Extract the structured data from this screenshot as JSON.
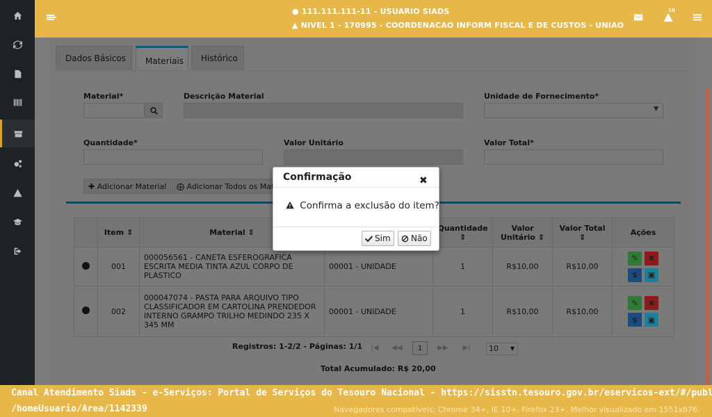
{
  "header": {
    "user": "111.111.111-11 - USUARIO SIADS",
    "unit": "NIVEL 1 - 170995 - COORDENACAO INFORM FISCAL E DE CUSTOS - UNIAO",
    "notification_count": "10"
  },
  "sidebar": {
    "items": [
      "home-icon",
      "refresh-icon",
      "document-icon",
      "barcode-icon",
      "inventory-icon",
      "gears-icon",
      "warning-icon",
      "graduation-cap-icon",
      "logout-icon"
    ]
  },
  "tabs": [
    {
      "label": "Dados Básicos"
    },
    {
      "label": "Materiais"
    },
    {
      "label": "Histórico"
    }
  ],
  "form": {
    "material_label": "Material*",
    "descricao_label": "Descrição Material",
    "unidade_label": "Unidade de Fornecimento*",
    "quantidade_label": "Quantidade*",
    "valor_unitario_label": "Valor Unitário",
    "valor_total_label": "Valor Total*",
    "add_material": "Adicionar Material",
    "add_all": "Adicionar Todos os Mat"
  },
  "table": {
    "headers": [
      "Item",
      "Material",
      "Quantidade",
      "Valor Unitário",
      "Valor Total",
      "Ações"
    ],
    "rows": [
      {
        "item": "001",
        "material": "000056561 - CANETA ESFEROGRAFICA ESCRITA MEDIA TINTA AZUL CORPO DE PLASTICO",
        "unidade": "00001 - UNIDADE",
        "quantidade": "1",
        "valor_unitario": "R$10,00",
        "valor_total": "R$10,00"
      },
      {
        "item": "002",
        "material": "000047074 - PASTA PARA ARQUIVO TIPO CLASSIFICADOR EM CARTOLINA PRENDEDOR INTERNO GRAMPO TRILHO MEDINDO 235 X 345 MM",
        "unidade": "00001 - UNIDADE",
        "quantidade": "1",
        "valor_unitario": "R$10,00",
        "valor_total": "R$10,00"
      }
    ]
  },
  "pager": {
    "summary": "Registros: 1-2/2 - Páginas: 1/1",
    "current_page": "1",
    "page_size": "10"
  },
  "total": "Total Acumulado: R$ 20,00",
  "footer": {
    "line1": "Canal Atendimento Siads - e-Serviços: Portal de Serviços do Tesouro Nacional - https://sisstn.tesouro.gov.br/eservicos-ext/#/public",
    "line2": "/homeUsuario/Area/1142339",
    "note": "Navegadores compatíveis: Chrome 34+, IE 10+, Firefox 23+. Melhor visualizado em 1551x876."
  },
  "modal": {
    "title": "Confirmação",
    "message": "Confirma a exclusão do item?",
    "yes": "Sim",
    "no": "Não"
  }
}
